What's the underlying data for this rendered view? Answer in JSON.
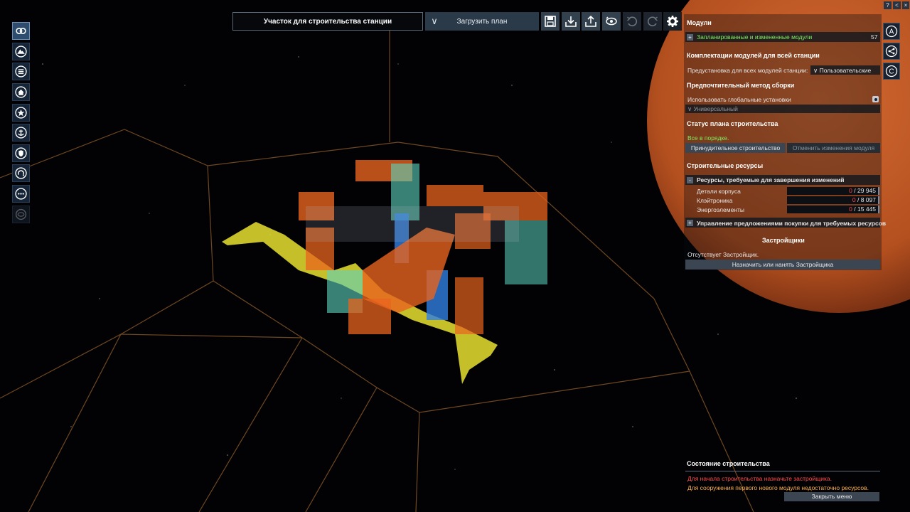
{
  "top_bar": {
    "title": "Участок для строительства станции",
    "load_plan_label": "Загрузить план",
    "toolbar_icons": [
      "save-icon",
      "download-icon",
      "upload-icon",
      "view-rotate-icon",
      "undo-icon",
      "redo-icon",
      "gear-icon"
    ]
  },
  "left_toolbar": {
    "icons": [
      "overview-icon",
      "mountain-icon",
      "list-icon",
      "home-icon",
      "star-icon",
      "anchor-icon",
      "shield-icon",
      "recycle-icon",
      "more-icon",
      "disabled-ring-icon"
    ]
  },
  "corner_buttons": [
    "?",
    "<",
    "<",
    "×"
  ],
  "right_side_buttons": [
    "A",
    "<",
    "C"
  ],
  "panel": {
    "modules_title": "Модули",
    "planned_modules_label": "Запланированные и измененные модули",
    "planned_modules_count": "57",
    "kit_title": "Комплектации модулей для всей станции",
    "preset_label": "Предустановка для всех модулей станции:",
    "preset_value": "Пользовательские",
    "method_title": "Предпочтительный метод сборки",
    "use_global_label": "Использовать глобальные установки",
    "method_value": "Универсальный",
    "status_title": "Статус плана строительства",
    "status_ok": "Все в порядке.",
    "force_build_label": "Принудительное строительство",
    "cancel_changes_label": "Отменить изменения модуля",
    "resources_title": "Строительные ресурсы",
    "resources_required_label": "Ресурсы, требуемые для завершения изменений",
    "resources": [
      {
        "name": "Детали корпуса",
        "have": "0",
        "need": "29 945"
      },
      {
        "name": "Клэйтроника",
        "have": "0",
        "need": "8 097"
      },
      {
        "name": "Энергоэлементы",
        "have": "0",
        "need": "15 445"
      }
    ],
    "offers_label": "Управление предложениями покупки для требуемых ресурсов",
    "builders_title": "Застройщики",
    "no_builder": "Отсутствует Застройщик.",
    "assign_builder_label": "Назначить или нанять Застройщика"
  },
  "construction_state": {
    "title": "Состояние строительства",
    "warning_builder": "Для начала строительства назначьте застройщика.",
    "warning_resources": "Для сооружения первого нового модуля недостаточно ресурсов.",
    "close_menu_label": "Закрыть меню"
  },
  "colors": {
    "planet": "#c8612e",
    "grid_lines": "#a06a30",
    "module_orange": "#e8641e",
    "module_teal": "#5fd6bf",
    "module_blue": "#2f7fe0",
    "module_yellow": "#e8e030",
    "green_text": "#7cf060",
    "red_text": "#ff4a4a",
    "orange_text": "#ffb04a"
  }
}
